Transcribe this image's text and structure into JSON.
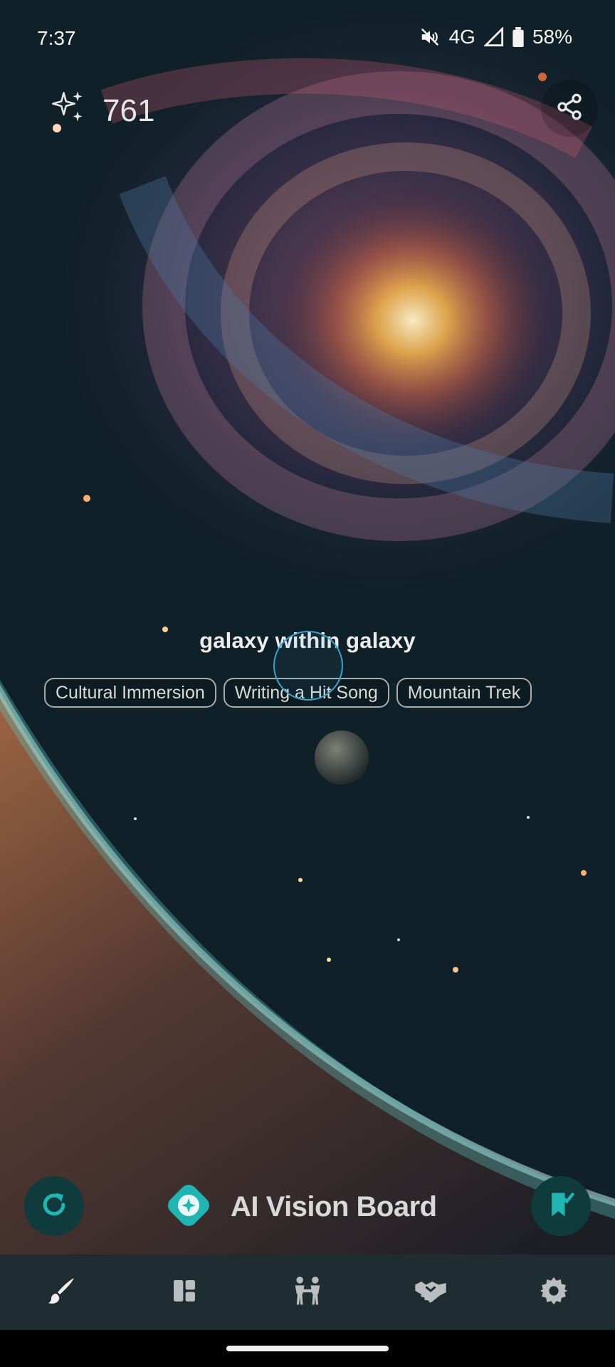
{
  "status": {
    "time": "7:37",
    "network": "4G",
    "battery": "58%"
  },
  "credits": {
    "count": "761"
  },
  "prompt": {
    "text": "galaxy within galaxy"
  },
  "tags": [
    "Cultural Immersion",
    "Writing a Hit Song",
    "Mountain Trek"
  ],
  "brand": {
    "title": "AI Vision Board"
  },
  "icons": {
    "credits": "sparkles-icon",
    "share": "share-icon",
    "refresh": "refresh-icon",
    "save": "bookmark-check-icon",
    "nav": [
      "brush-icon",
      "dashboard-icon",
      "people-icon",
      "handshake-icon",
      "gear-icon"
    ]
  },
  "colors": {
    "accent": "#1fb5b3",
    "button_bg": "#0f3b3c",
    "nav_bg": "#1f2c31"
  }
}
